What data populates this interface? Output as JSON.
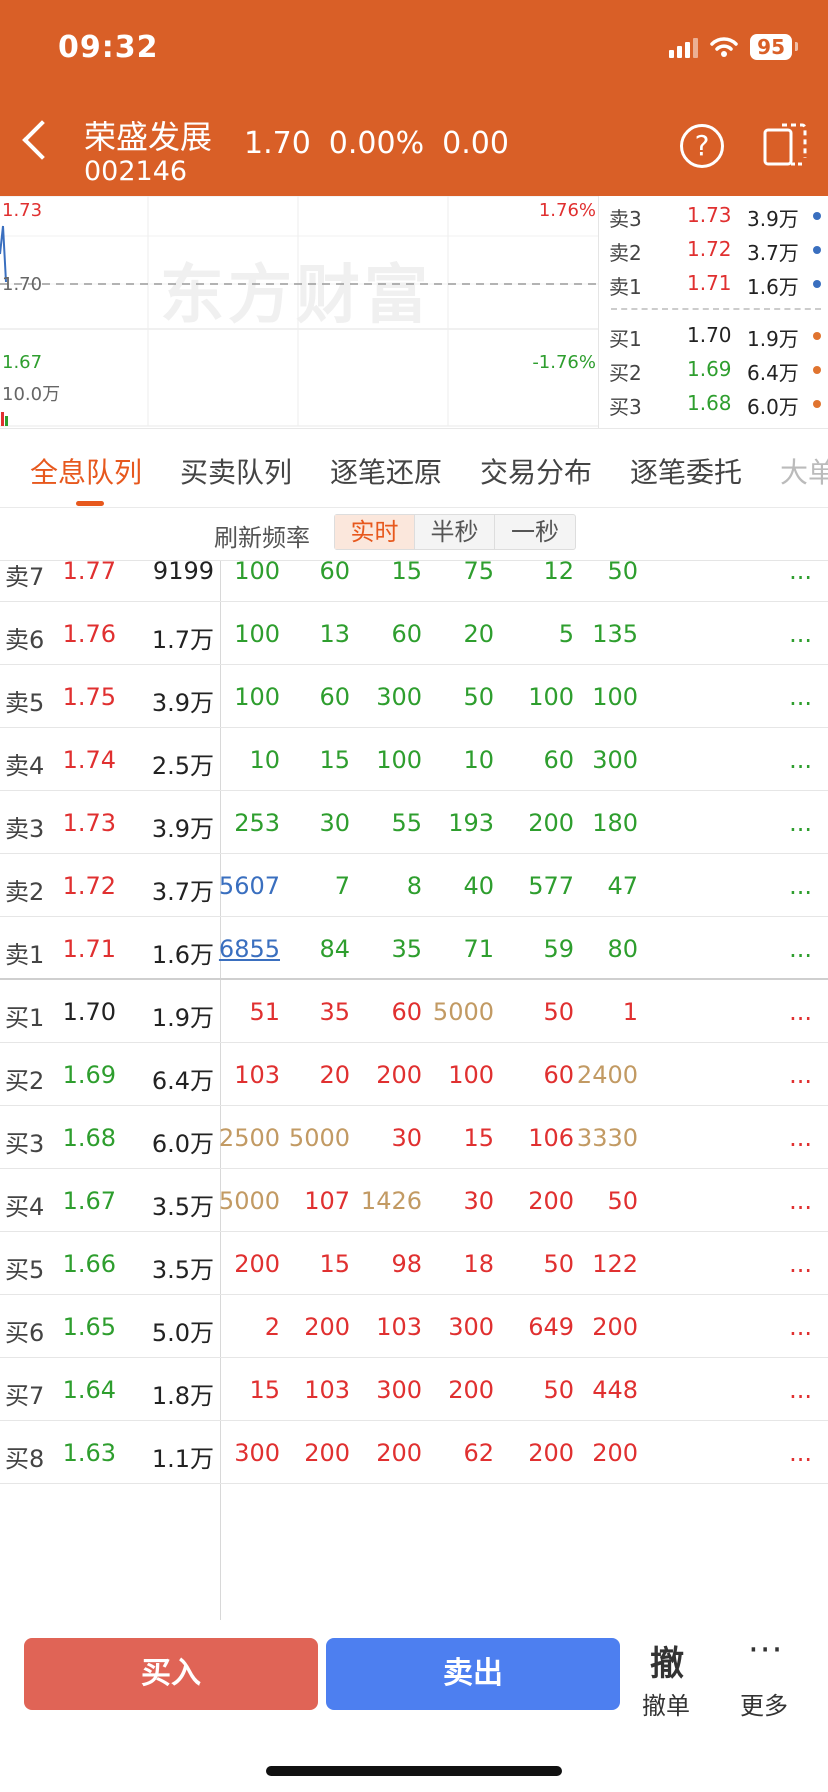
{
  "status_bar": {
    "time": "09:32",
    "battery": "95"
  },
  "header": {
    "stock_name": "荣盛发展",
    "stock_code": "002146",
    "price": "1.70",
    "change_pct": "0.00%",
    "change": "0.00"
  },
  "chart": {
    "price_high": "1.73",
    "price_mid": "1.70",
    "price_low": "1.67",
    "pct_high": "1.76%",
    "pct_low": "-1.76%",
    "volume_label": "10.0万",
    "watermark": "东方财富"
  },
  "order_book": {
    "asks": [
      {
        "label": "卖3",
        "price": "1.73",
        "volume": "3.9万"
      },
      {
        "label": "卖2",
        "price": "1.72",
        "volume": "3.7万"
      },
      {
        "label": "卖1",
        "price": "1.71",
        "volume": "1.6万"
      }
    ],
    "bids": [
      {
        "label": "买1",
        "price": "1.70",
        "volume": "1.9万"
      },
      {
        "label": "买2",
        "price": "1.69",
        "volume": "6.4万"
      },
      {
        "label": "买3",
        "price": "1.68",
        "volume": "6.0万"
      }
    ]
  },
  "tabs": [
    "全息队列",
    "买卖队列",
    "逐笔还原",
    "交易分布",
    "逐笔委托",
    "大单"
  ],
  "refresh": {
    "label": "刷新频率",
    "options": [
      "实时",
      "半秒",
      "一秒"
    ]
  },
  "table": {
    "rows": [
      {
        "label": "卖7",
        "price": "1.77",
        "volume": "9199",
        "q": [
          "100",
          "60",
          "15",
          "75",
          "12",
          "50"
        ]
      },
      {
        "label": "卖6",
        "price": "1.76",
        "volume": "1.7万",
        "q": [
          "100",
          "13",
          "60",
          "20",
          "5",
          "135"
        ]
      },
      {
        "label": "卖5",
        "price": "1.75",
        "volume": "3.9万",
        "q": [
          "100",
          "60",
          "300",
          "50",
          "100",
          "100"
        ]
      },
      {
        "label": "卖4",
        "price": "1.74",
        "volume": "2.5万",
        "q": [
          "10",
          "15",
          "100",
          "10",
          "60",
          "300"
        ]
      },
      {
        "label": "卖3",
        "price": "1.73",
        "volume": "3.9万",
        "q": [
          "253",
          "30",
          "55",
          "193",
          "200",
          "180"
        ]
      },
      {
        "label": "卖2",
        "price": "1.72",
        "volume": "3.7万",
        "q": [
          "5607",
          "7",
          "8",
          "40",
          "577",
          "47"
        ]
      },
      {
        "label": "卖1",
        "price": "1.71",
        "volume": "1.6万",
        "q": [
          "6855",
          "84",
          "35",
          "71",
          "59",
          "80"
        ]
      },
      {
        "label": "买1",
        "price": "1.70",
        "volume": "1.9万",
        "q": [
          "51",
          "35",
          "60",
          "5000",
          "50",
          "1"
        ]
      },
      {
        "label": "买2",
        "price": "1.69",
        "volume": "6.4万",
        "q": [
          "103",
          "20",
          "200",
          "100",
          "60",
          "2400"
        ]
      },
      {
        "label": "买3",
        "price": "1.68",
        "volume": "6.0万",
        "q": [
          "2500",
          "5000",
          "30",
          "15",
          "106",
          "3330"
        ]
      },
      {
        "label": "买4",
        "price": "1.67",
        "volume": "3.5万",
        "q": [
          "5000",
          "107",
          "1426",
          "30",
          "200",
          "50"
        ]
      },
      {
        "label": "买5",
        "price": "1.66",
        "volume": "3.5万",
        "q": [
          "200",
          "15",
          "98",
          "18",
          "50",
          "122"
        ]
      },
      {
        "label": "买6",
        "price": "1.65",
        "volume": "5.0万",
        "q": [
          "2",
          "200",
          "103",
          "300",
          "649",
          "200"
        ]
      },
      {
        "label": "买7",
        "price": "1.64",
        "volume": "1.8万",
        "q": [
          "15",
          "103",
          "300",
          "200",
          "50",
          "448"
        ]
      },
      {
        "label": "买8",
        "price": "1.63",
        "volume": "1.1万",
        "q": [
          "300",
          "200",
          "200",
          "62",
          "200",
          "200"
        ]
      }
    ],
    "more": "..."
  },
  "bottom": {
    "buy": "买入",
    "sell": "卖出",
    "cancel_glyph": "撤",
    "cancel_label": "撤单",
    "more_glyph": "···",
    "more_label": "更多"
  },
  "colors": {
    "brand": "#d95f27",
    "up": "#e03030",
    "down": "#2e9e2e",
    "neutral": "#222222",
    "large": "#c29a63",
    "link": "#3a6fbf"
  }
}
